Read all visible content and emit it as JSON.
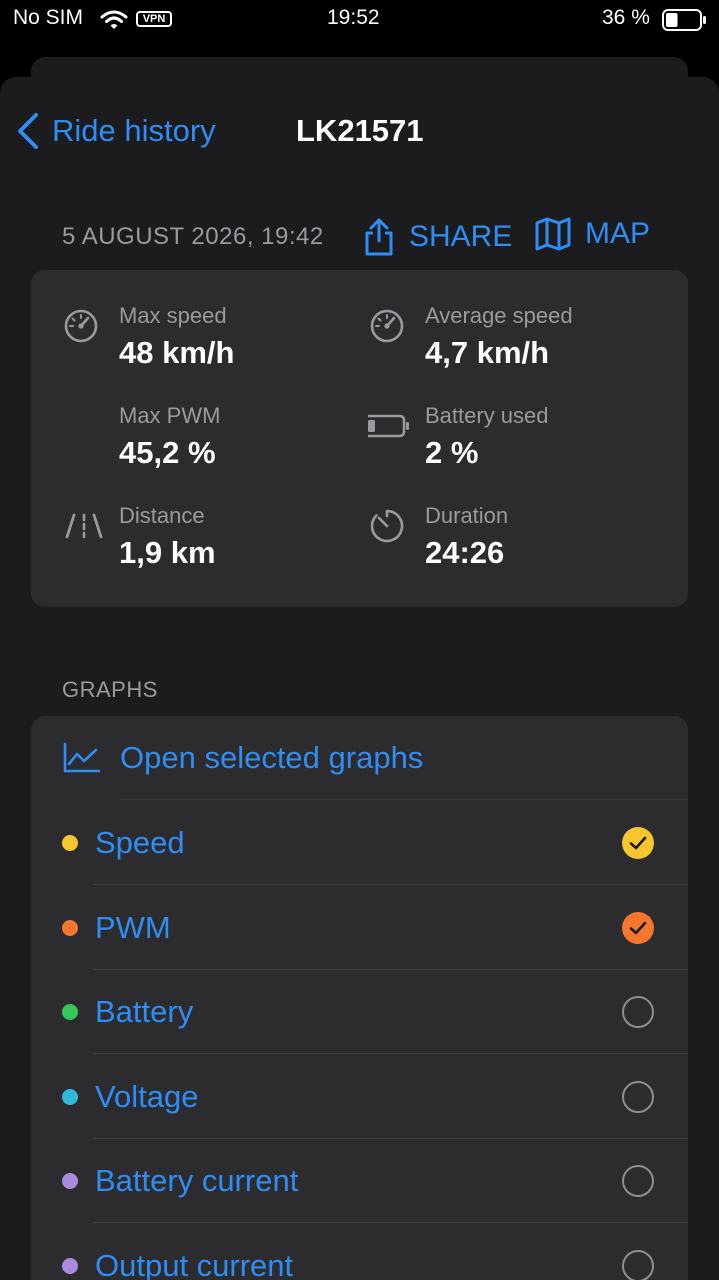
{
  "status_bar": {
    "carrier": "No SIM",
    "vpn": "VPN",
    "time": "19:52",
    "battery_percent": "36 %",
    "battery_level": 0.36
  },
  "nav": {
    "back_label": "Ride history",
    "title": "LK21571"
  },
  "ride": {
    "date": "5 AUGUST 2026, 19:42",
    "share_label": "SHARE",
    "map_label": "MAP"
  },
  "stats": {
    "max_speed": {
      "label": "Max speed",
      "value": "48 km/h",
      "icon": "speedometer-icon"
    },
    "average_speed": {
      "label": "Average speed",
      "value": "4,7 km/h",
      "icon": "speedometer-icon"
    },
    "max_pwm": {
      "label": "Max PWM",
      "value": "45,2 %"
    },
    "battery_used": {
      "label": "Battery used",
      "value": "2 %",
      "icon": "battery-icon"
    },
    "distance": {
      "label": "Distance",
      "value": "1,9 km",
      "icon": "road-icon"
    },
    "duration": {
      "label": "Duration",
      "value": "24:26",
      "icon": "timer-icon"
    }
  },
  "graphs": {
    "header": "GRAPHS",
    "open_label": "Open selected graphs",
    "items": [
      {
        "label": "Speed",
        "color": "#f7c52d",
        "checked": true
      },
      {
        "label": "PWM",
        "color": "#f5762c",
        "checked": true
      },
      {
        "label": "Battery",
        "color": "#34c759",
        "checked": false
      },
      {
        "label": "Voltage",
        "color": "#30b8dd",
        "checked": false
      },
      {
        "label": "Battery current",
        "color": "#a98be0",
        "checked": false
      },
      {
        "label": "Output current",
        "color": "#a98be0",
        "checked": false
      }
    ]
  },
  "colors": {
    "accent": "#2f8df6",
    "background": "#1c1c1e",
    "card": "#2c2c2e",
    "secondary_text": "#9a9aa0"
  }
}
